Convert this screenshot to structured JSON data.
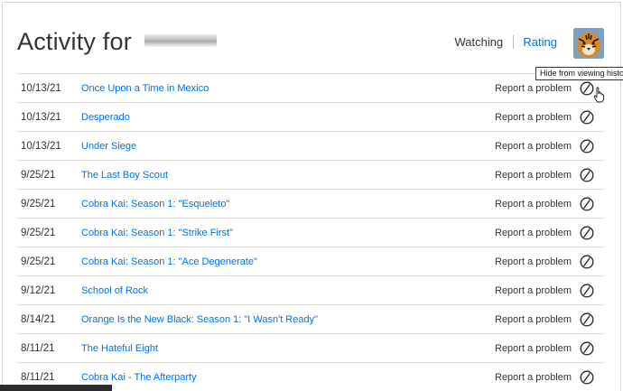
{
  "header": {
    "title": "Activity for",
    "watching_label": "Watching",
    "rating_label": "Rating"
  },
  "tooltip": "Hide from viewing history",
  "report_label": "Report a problem",
  "hide_icon": "circle-slash-icon",
  "rows": [
    {
      "date": "10/13/21",
      "title": "Once Upon a Time in Mexico"
    },
    {
      "date": "10/13/21",
      "title": "Desperado"
    },
    {
      "date": "10/13/21",
      "title": "Under Siege"
    },
    {
      "date": "9/25/21",
      "title": "The Last Boy Scout"
    },
    {
      "date": "9/25/21",
      "title": "Cobra Kai: Season 1: \"Esqueleto\""
    },
    {
      "date": "9/25/21",
      "title": "Cobra Kai: Season 1: \"Strike First\""
    },
    {
      "date": "9/25/21",
      "title": "Cobra Kai: Season 1: \"Ace Degenerate\""
    },
    {
      "date": "9/12/21",
      "title": "School of Rock"
    },
    {
      "date": "8/14/21",
      "title": "Orange Is the New Black: Season 1: \"I Wasn't Ready\""
    },
    {
      "date": "8/11/21",
      "title": "The Hateful Eight"
    },
    {
      "date": "8/11/21",
      "title": "Cobra Kai - The Afterparty"
    }
  ],
  "colors": {
    "link": "#0071eb",
    "text": "#333333",
    "divider": "#dddddd"
  }
}
